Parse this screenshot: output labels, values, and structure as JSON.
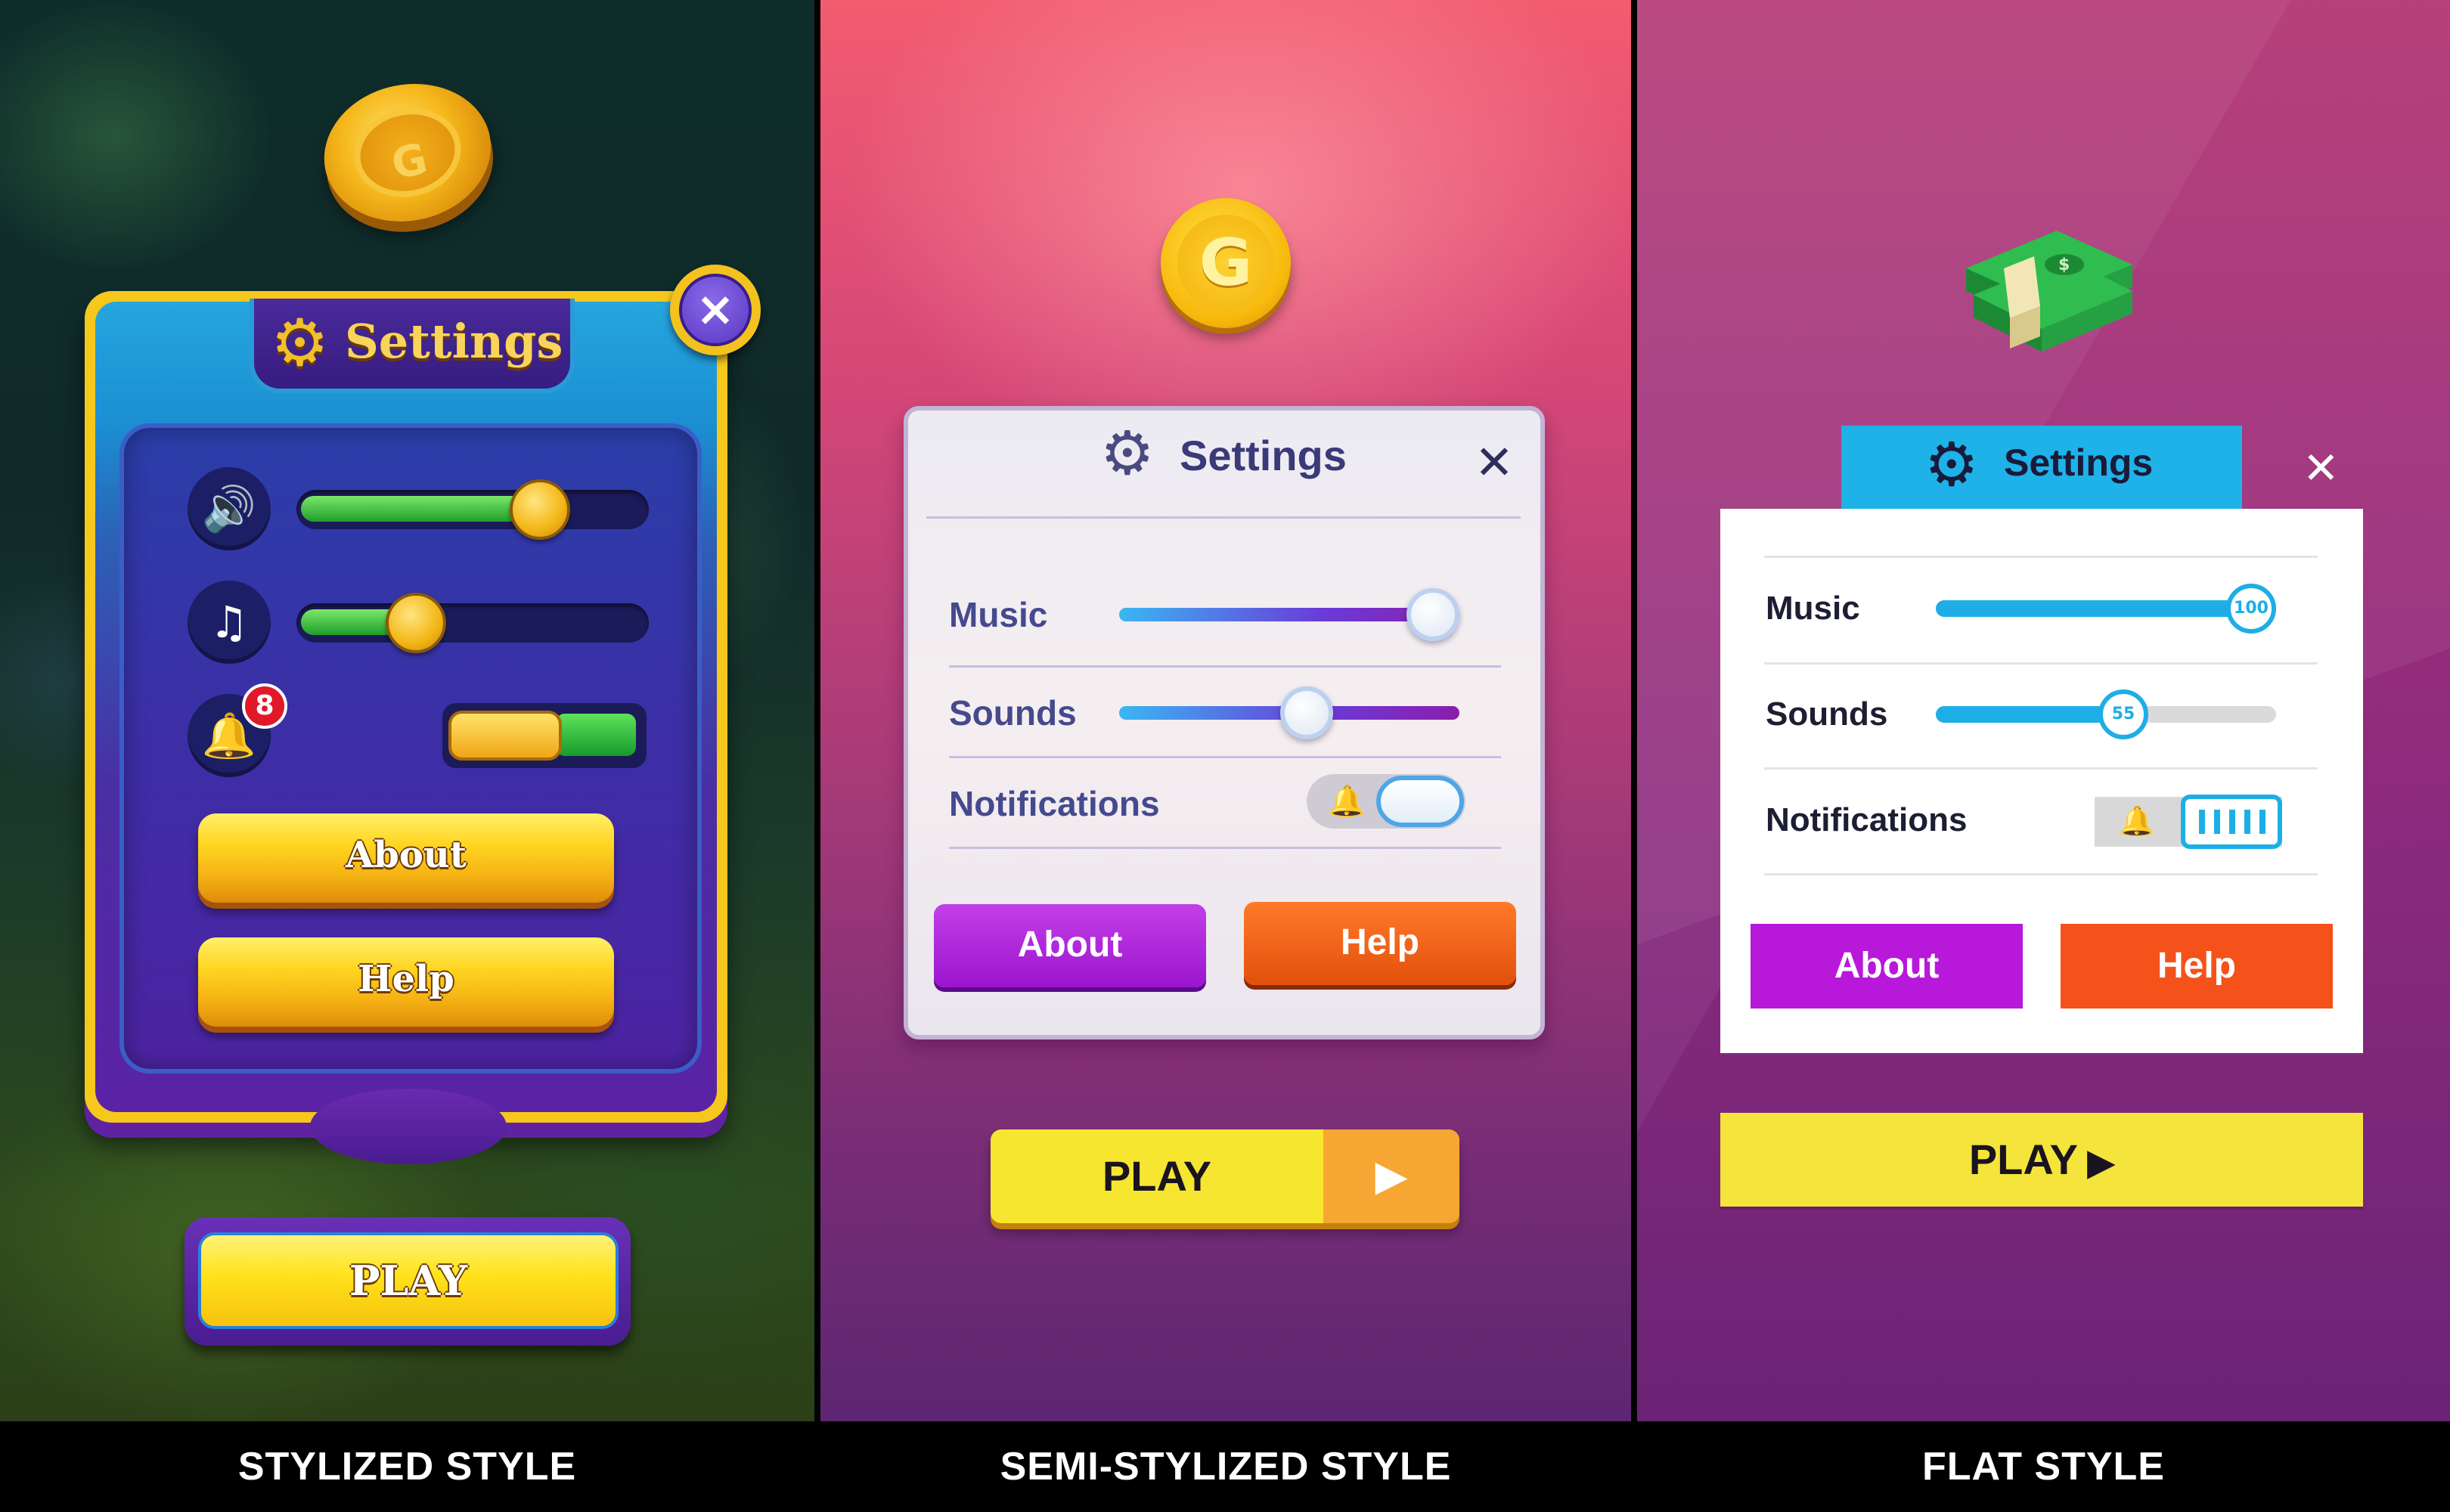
{
  "panels": {
    "stylized": {
      "caption": "STYLIZED STYLE",
      "title": "Settings",
      "sliders": [
        {
          "icon": "speaker-icon",
          "value": 0.69
        },
        {
          "icon": "music-note-icon",
          "value": 0.34
        }
      ],
      "notifications": {
        "icon": "bell-icon",
        "badge": "8",
        "enabled": true
      },
      "about_label": "About",
      "help_label": "Help",
      "play_label": "PLAY"
    },
    "semi": {
      "caption": "SEMI-STYLIZED STYLE",
      "title": "Settings",
      "close": "✕",
      "music_label": "Music",
      "music_value": 1.0,
      "sounds_label": "Sounds",
      "sounds_value": 0.55,
      "notifications_label": "Notifications",
      "notifications_enabled": true,
      "about_label": "About",
      "help_label": "Help",
      "play_label": "PLAY",
      "coin_letter": "G"
    },
    "flat": {
      "caption": "FLAT STYLE",
      "title": "Settings",
      "close": "✕",
      "music_label": "Music",
      "music_value": "100",
      "sounds_label": "Sounds",
      "sounds_value": "55",
      "notifications_label": "Notifications",
      "notifications_enabled": true,
      "about_label": "About",
      "help_label": "Help",
      "play_label": "PLAY"
    }
  },
  "colors": {
    "flat_accent": "#1eaee6",
    "about_purple": "#b818da",
    "help_orange": "#f4521a",
    "play_yellow": "#f4e43c"
  }
}
